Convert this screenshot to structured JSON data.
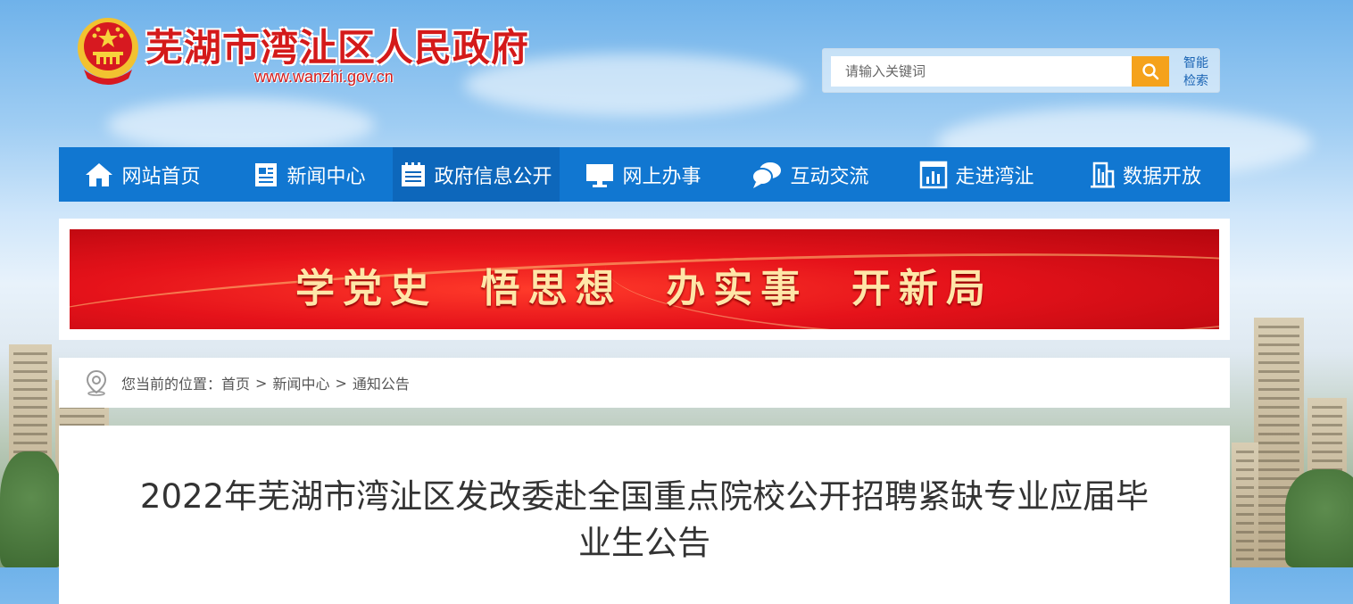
{
  "header": {
    "title": "芜湖市湾沚区人民政府",
    "url": "www.wanzhi.gov.cn"
  },
  "search": {
    "placeholder": "请输入关键词",
    "smart_search_label": "智能检索"
  },
  "nav": {
    "items": [
      {
        "label": "网站首页",
        "icon": "home-icon"
      },
      {
        "label": "新闻中心",
        "icon": "news-icon"
      },
      {
        "label": "政府信息公开",
        "icon": "calendar-list-icon"
      },
      {
        "label": "网上办事",
        "icon": "monitor-icon"
      },
      {
        "label": "互动交流",
        "icon": "chat-bubbles-icon"
      },
      {
        "label": "走进湾沚",
        "icon": "bar-chart-icon"
      },
      {
        "label": "数据开放",
        "icon": "buildings-chart-icon"
      }
    ],
    "active_index": 2
  },
  "banner": {
    "text": "学党史  悟思想  办实事  开新局"
  },
  "breadcrumb": {
    "prefix": "您当前的位置：",
    "items": [
      "首页",
      "新闻中心",
      "通知公告"
    ],
    "separator": ">"
  },
  "article": {
    "title": "2022年芜湖市湾沚区发改委赴全国重点院校公开招聘紧缺专业应届毕业生公告"
  },
  "colors": {
    "nav_bg": "#1177d1",
    "nav_active_bg": "#0d67bb",
    "search_button": "#f5a21b",
    "title_red": "#d41a1a",
    "banner_red": "#e5121a"
  }
}
